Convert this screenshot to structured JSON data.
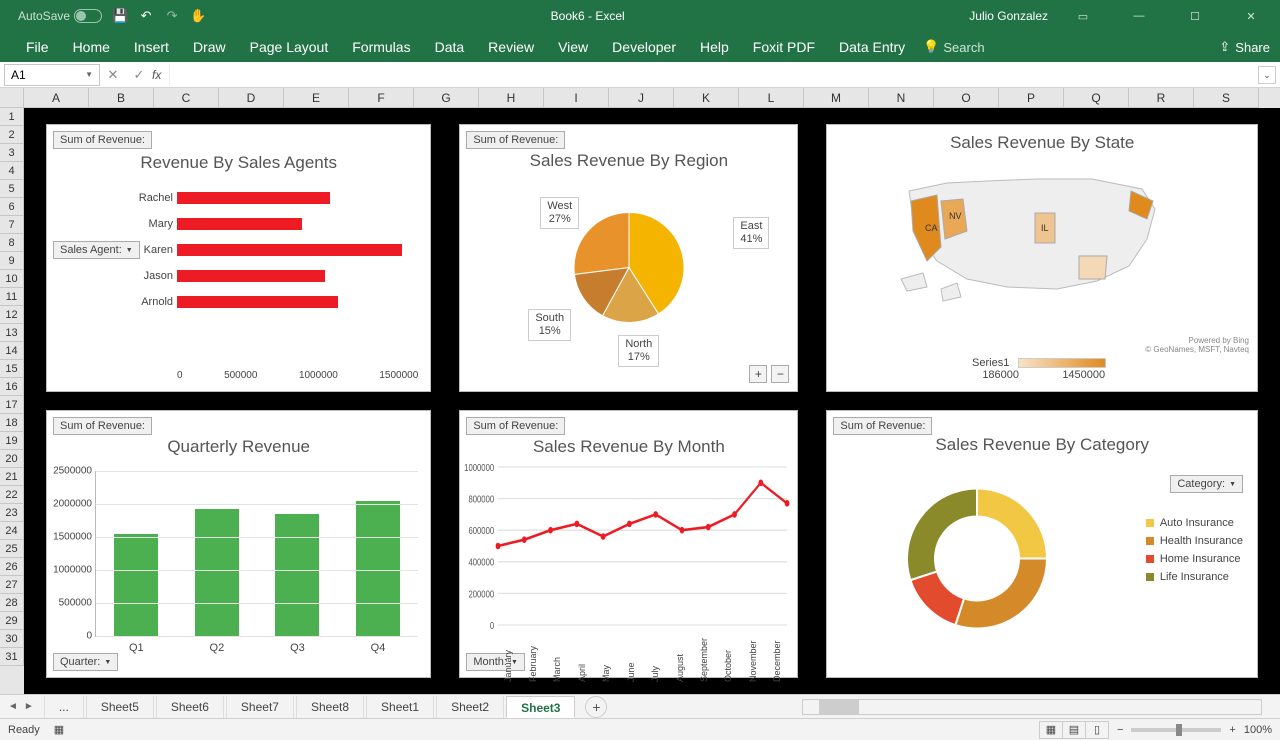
{
  "titlebar": {
    "autosave": "AutoSave",
    "autosave_state": "Off",
    "title": "Book6 - Excel",
    "user": "Julio Gonzalez"
  },
  "ribbon": {
    "tabs": [
      "File",
      "Home",
      "Insert",
      "Draw",
      "Page Layout",
      "Formulas",
      "Data",
      "Review",
      "View",
      "Developer",
      "Help",
      "Foxit PDF",
      "Data Entry"
    ],
    "tell": "Search",
    "share": "Share"
  },
  "namebox": "A1",
  "columns": [
    "A",
    "B",
    "C",
    "D",
    "E",
    "F",
    "G",
    "H",
    "I",
    "J",
    "K",
    "L",
    "M",
    "N",
    "O",
    "P",
    "Q",
    "R",
    "S"
  ],
  "rows_visible": 31,
  "panel_label": "Sum of Revenue:",
  "slicers": {
    "agent": "Sales Agent:",
    "quarter": "Quarter:",
    "month": "Month:",
    "category": "Category:"
  },
  "map_credit1": "Powered by Bing",
  "map_credit2": "© GeoNames, MSFT, Navteq",
  "map_series": "Series1",
  "map_min": "186000",
  "map_max": "1450000",
  "sheet_tabs": [
    "Sheet5",
    "Sheet6",
    "Sheet7",
    "Sheet8",
    "Sheet1",
    "Sheet2",
    "Sheet3"
  ],
  "sheet_ellipsis": "...",
  "active_sheet": "Sheet3",
  "status": {
    "ready": "Ready",
    "zoom": "100%"
  },
  "chart_data": [
    {
      "type": "bar",
      "orientation": "horizontal",
      "title": "Revenue By Sales Agents",
      "categories": [
        "Rachel",
        "Mary",
        "Karen",
        "Jason",
        "Arnold"
      ],
      "values": [
        950000,
        780000,
        1400000,
        920000,
        1000000
      ],
      "xlim": [
        0,
        1500000
      ],
      "xticks": [
        0,
        500000,
        1000000,
        1500000
      ]
    },
    {
      "type": "pie",
      "title": "Sales Revenue By Region",
      "categories": [
        "East",
        "North",
        "South",
        "West"
      ],
      "values": [
        41,
        17,
        15,
        27
      ],
      "value_suffix": "%"
    },
    {
      "type": "bar",
      "title": "Quarterly Revenue",
      "categories": [
        "Q1",
        "Q2",
        "Q3",
        "Q4"
      ],
      "values": [
        1550000,
        1920000,
        1850000,
        2050000
      ],
      "ylim": [
        0,
        2500000
      ],
      "yticks": [
        0,
        500000,
        1000000,
        1500000,
        2000000,
        2500000
      ]
    },
    {
      "type": "line",
      "title": "Sales Revenue By Month",
      "categories": [
        "January",
        "February",
        "March",
        "April",
        "May",
        "June",
        "July",
        "August",
        "September",
        "October",
        "November",
        "December"
      ],
      "values": [
        500000,
        540000,
        600000,
        640000,
        560000,
        640000,
        700000,
        600000,
        620000,
        700000,
        900000,
        770000
      ],
      "ylim": [
        0,
        1000000
      ],
      "yticks": [
        0,
        200000,
        400000,
        600000,
        800000,
        1000000
      ]
    },
    {
      "type": "pie",
      "donut": true,
      "title": "Sales Revenue By Category",
      "categories": [
        "Auto Insurance",
        "Health Insurance",
        "Home Insurance",
        "Life Insurance"
      ],
      "values": [
        25,
        30,
        15,
        30
      ],
      "colors": [
        "#f2c744",
        "#d58a2a",
        "#e34b2e",
        "#8a8a2a"
      ]
    },
    {
      "type": "map",
      "title": "Sales Revenue By State",
      "region": "USA",
      "highlighted": {
        "CA": 1450000,
        "NV": 900000,
        "IL": 600000,
        "NY": 1200000
      },
      "range": [
        186000,
        1450000
      ]
    }
  ]
}
